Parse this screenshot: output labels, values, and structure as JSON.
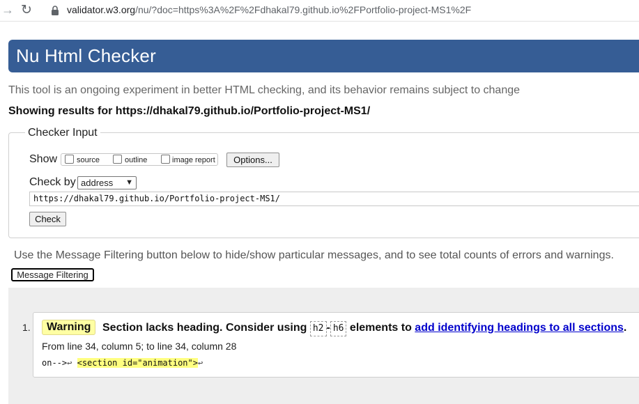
{
  "browser": {
    "url_host": "validator.w3.org",
    "url_rest": "/nu/?doc=https%3A%2F%2Fdhakal79.github.io%2FPortfolio-project-MS1%2F"
  },
  "page": {
    "title": "Nu Html Checker",
    "intro": "This tool is an ongoing experiment in better HTML checking, and its behavior remains subject to change",
    "results_prefix": "Showing results for ",
    "results_url": "https://dhakal79.github.io/Portfolio-project-MS1/"
  },
  "checker_input": {
    "legend": "Checker Input",
    "show_label": "Show",
    "options": [
      "source",
      "outline",
      "image report"
    ],
    "options_button": "Options...",
    "check_by_label": "Check by",
    "check_by_value": "address",
    "address_value": "https://dhakal79.github.io/Portfolio-project-MS1/",
    "check_button": "Check"
  },
  "filtering": {
    "note": "Use the Message Filtering button below to hide/show particular messages, and to see total counts of errors and warnings.",
    "button": "Message Filtering"
  },
  "messages": [
    {
      "number": "1.",
      "type": "Warning",
      "text_before": "Section lacks heading. Consider using ",
      "code1": "h2",
      "dash": "-",
      "code2": "h6",
      "text_middle": " elements to ",
      "link": "add identifying headings to all sections",
      "text_after": ".",
      "location": "From line 34, column 5; to line 34, column 28",
      "extract_pre": "on-->",
      "extract_highlight": "<section id=\"animation\">",
      "lf_symbol": "↩"
    }
  ],
  "icons": [
    "back-arrow-icon",
    "reload-icon",
    "lock-icon",
    "chevron-down-icon"
  ]
}
